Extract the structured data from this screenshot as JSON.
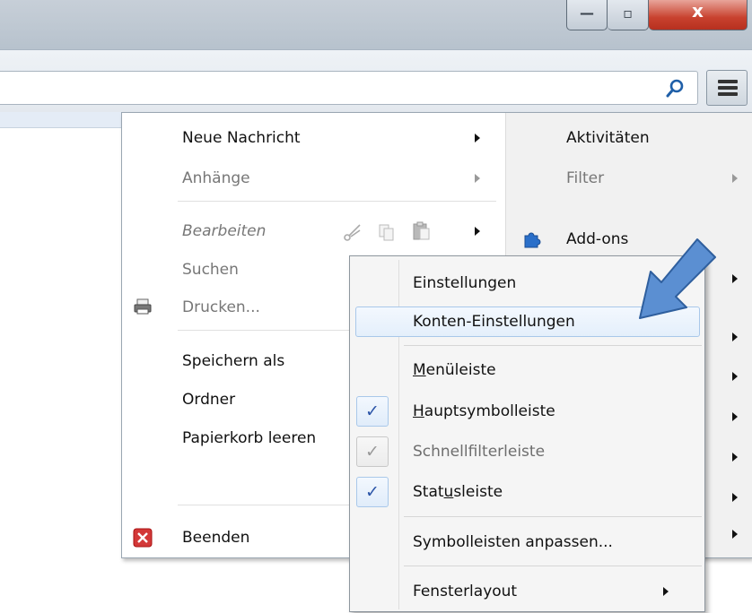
{
  "window": {
    "minimize_glyph": "—",
    "maximize_glyph": "▫",
    "close_glyph": "x"
  },
  "toolbar": {
    "search_value": "",
    "search_icon": "search-icon",
    "menu_icon": "hamburger-menu-icon"
  },
  "main_menu": {
    "left": [
      {
        "label": "Neue Nachricht",
        "enabled": true,
        "submenu": true
      },
      {
        "label": "Anhänge",
        "enabled": false,
        "submenu": true
      },
      {
        "label": "Bearbeiten",
        "enabled": false,
        "submenu": true
      },
      {
        "label": "Suchen",
        "enabled": false
      },
      {
        "label": "Drucken...",
        "enabled": false,
        "icon": "printer-icon"
      },
      {
        "label": "Speichern als",
        "enabled": true
      },
      {
        "label": "Ordner",
        "enabled": true
      },
      {
        "label": "Papierkorb leeren",
        "enabled": true
      },
      {
        "label": "Beenden",
        "enabled": true,
        "icon": "exit-icon"
      }
    ],
    "right": [
      {
        "label": "Aktivitäten",
        "enabled": true
      },
      {
        "label": "Filter",
        "enabled": false,
        "submenu": true
      },
      {
        "label": "Add-ons",
        "enabled": true,
        "icon": "puzzle-icon"
      }
    ]
  },
  "view_submenu": {
    "items": [
      {
        "label": "Einstellungen"
      },
      {
        "label": "Konten-Einstellungen",
        "highlighted": true
      },
      {
        "pre": "",
        "u": "M",
        "post": "enüleiste",
        "checked": false
      },
      {
        "pre": "",
        "u": "H",
        "post": "auptsymbolleiste",
        "checked": true
      },
      {
        "label": "Schnellfilterleiste",
        "checked": true,
        "enabled": false
      },
      {
        "pre": "Stat",
        "u": "u",
        "post": "sleiste",
        "checked": true
      },
      {
        "label": "Symbolleisten anpassen..."
      },
      {
        "label": "Fensterlayout",
        "submenu": true
      }
    ],
    "check_glyph": "✓"
  },
  "colors": {
    "accent_blue": "#2c55a8",
    "pointer_arrow": "#5b8fd2",
    "highlight_border": "#a9c8ea"
  }
}
